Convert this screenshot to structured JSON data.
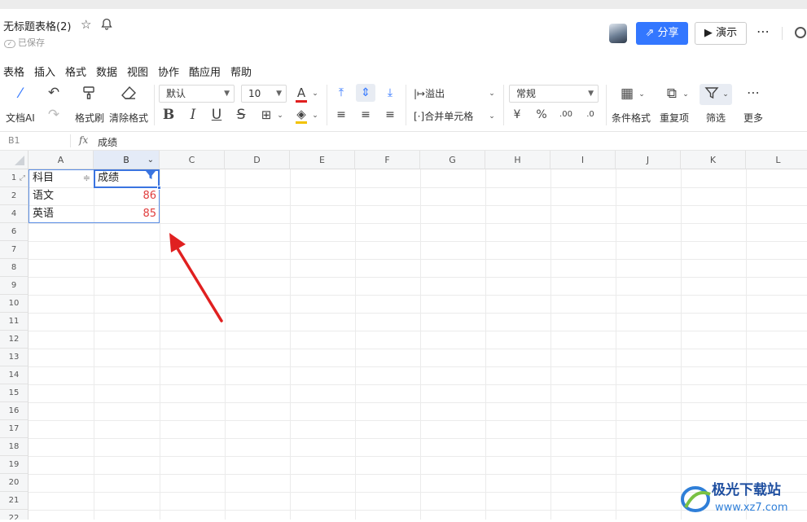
{
  "header": {
    "doc_title": "无标题表格(2)",
    "saved_status": "已保存",
    "share_label": "分享",
    "present_label": "演示"
  },
  "menu": [
    "表格",
    "插入",
    "格式",
    "数据",
    "视图",
    "协作",
    "酷应用",
    "帮助"
  ],
  "toolbar": {
    "ai_label": "文档AI",
    "format_painter_label": "格式刷",
    "clear_format_label": "清除格式",
    "font_name": "默认",
    "font_size": "10",
    "overflow_label": "溢出",
    "merge_label": "合并单元格",
    "number_format": "常规",
    "conditional_format_label": "条件格式",
    "duplicate_label": "重复项",
    "filter_label": "筛选",
    "more_label": "更多",
    "colors": {
      "font_color": "#e02020",
      "fill_color": "#f2c200",
      "accent": "#3377ff"
    }
  },
  "formula_bar": {
    "cell_ref": "B1",
    "fx": "fx",
    "value": "成绩"
  },
  "grid": {
    "columns": [
      "A",
      "B",
      "C",
      "D",
      "E",
      "F",
      "G",
      "H",
      "I",
      "J",
      "K",
      "L"
    ],
    "rows": [
      "1",
      "2",
      "4",
      "6",
      "7",
      "8",
      "9",
      "10",
      "11",
      "12",
      "13",
      "14",
      "15",
      "16",
      "17",
      "18",
      "19",
      "20",
      "21",
      "22"
    ],
    "table": {
      "headers": [
        "科目",
        "成绩"
      ],
      "data": [
        [
          "语文",
          "86"
        ],
        [
          "英语",
          "85"
        ]
      ]
    },
    "number_color": "#e03c3c"
  },
  "watermark": {
    "title": "极光下载站",
    "url": "www.xz7.com"
  }
}
